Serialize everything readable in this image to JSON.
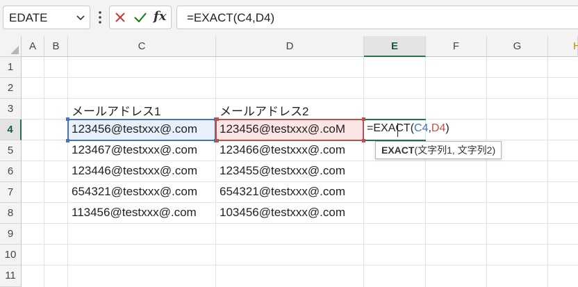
{
  "name_box": {
    "value": "EDATE"
  },
  "formula_bar": {
    "value": "=EXACT(C4,D4)"
  },
  "columns": [
    "A",
    "B",
    "C",
    "D",
    "E",
    "F",
    "G",
    "H"
  ],
  "rows": [
    "1",
    "2",
    "3",
    "4",
    "5",
    "6",
    "7",
    "8",
    "9",
    "10",
    "11"
  ],
  "cells": {
    "C3": "メールアドレス1",
    "D3": "メールアドレス2",
    "C4": "123456@testxxx@.com",
    "D4": "123456@testxxx@.coM",
    "C5": "123467@testxxx@.com",
    "D5": "123466@testxxx@.com",
    "C6": "123446@testxxx@.com",
    "D6": "123455@testxxx@.com",
    "C7": "654321@testxxx@.com",
    "D7": "654321@testxxx@.com",
    "C8": "113456@testxxx@.com",
    "D8": "103456@testxxx@.com"
  },
  "edit_cell": {
    "prefix": "=EXACT(",
    "ref1": "C4",
    "sep": ",",
    "ref2": "D4",
    "suffix": ")"
  },
  "tooltip": {
    "func": "EXACT",
    "args": "(文字列1, 文字列2)"
  },
  "colors": {
    "accent": "#217346",
    "ref1": "#4472c4",
    "ref2": "#c0504d",
    "cancel": "#d13438",
    "enter": "#107c10"
  }
}
